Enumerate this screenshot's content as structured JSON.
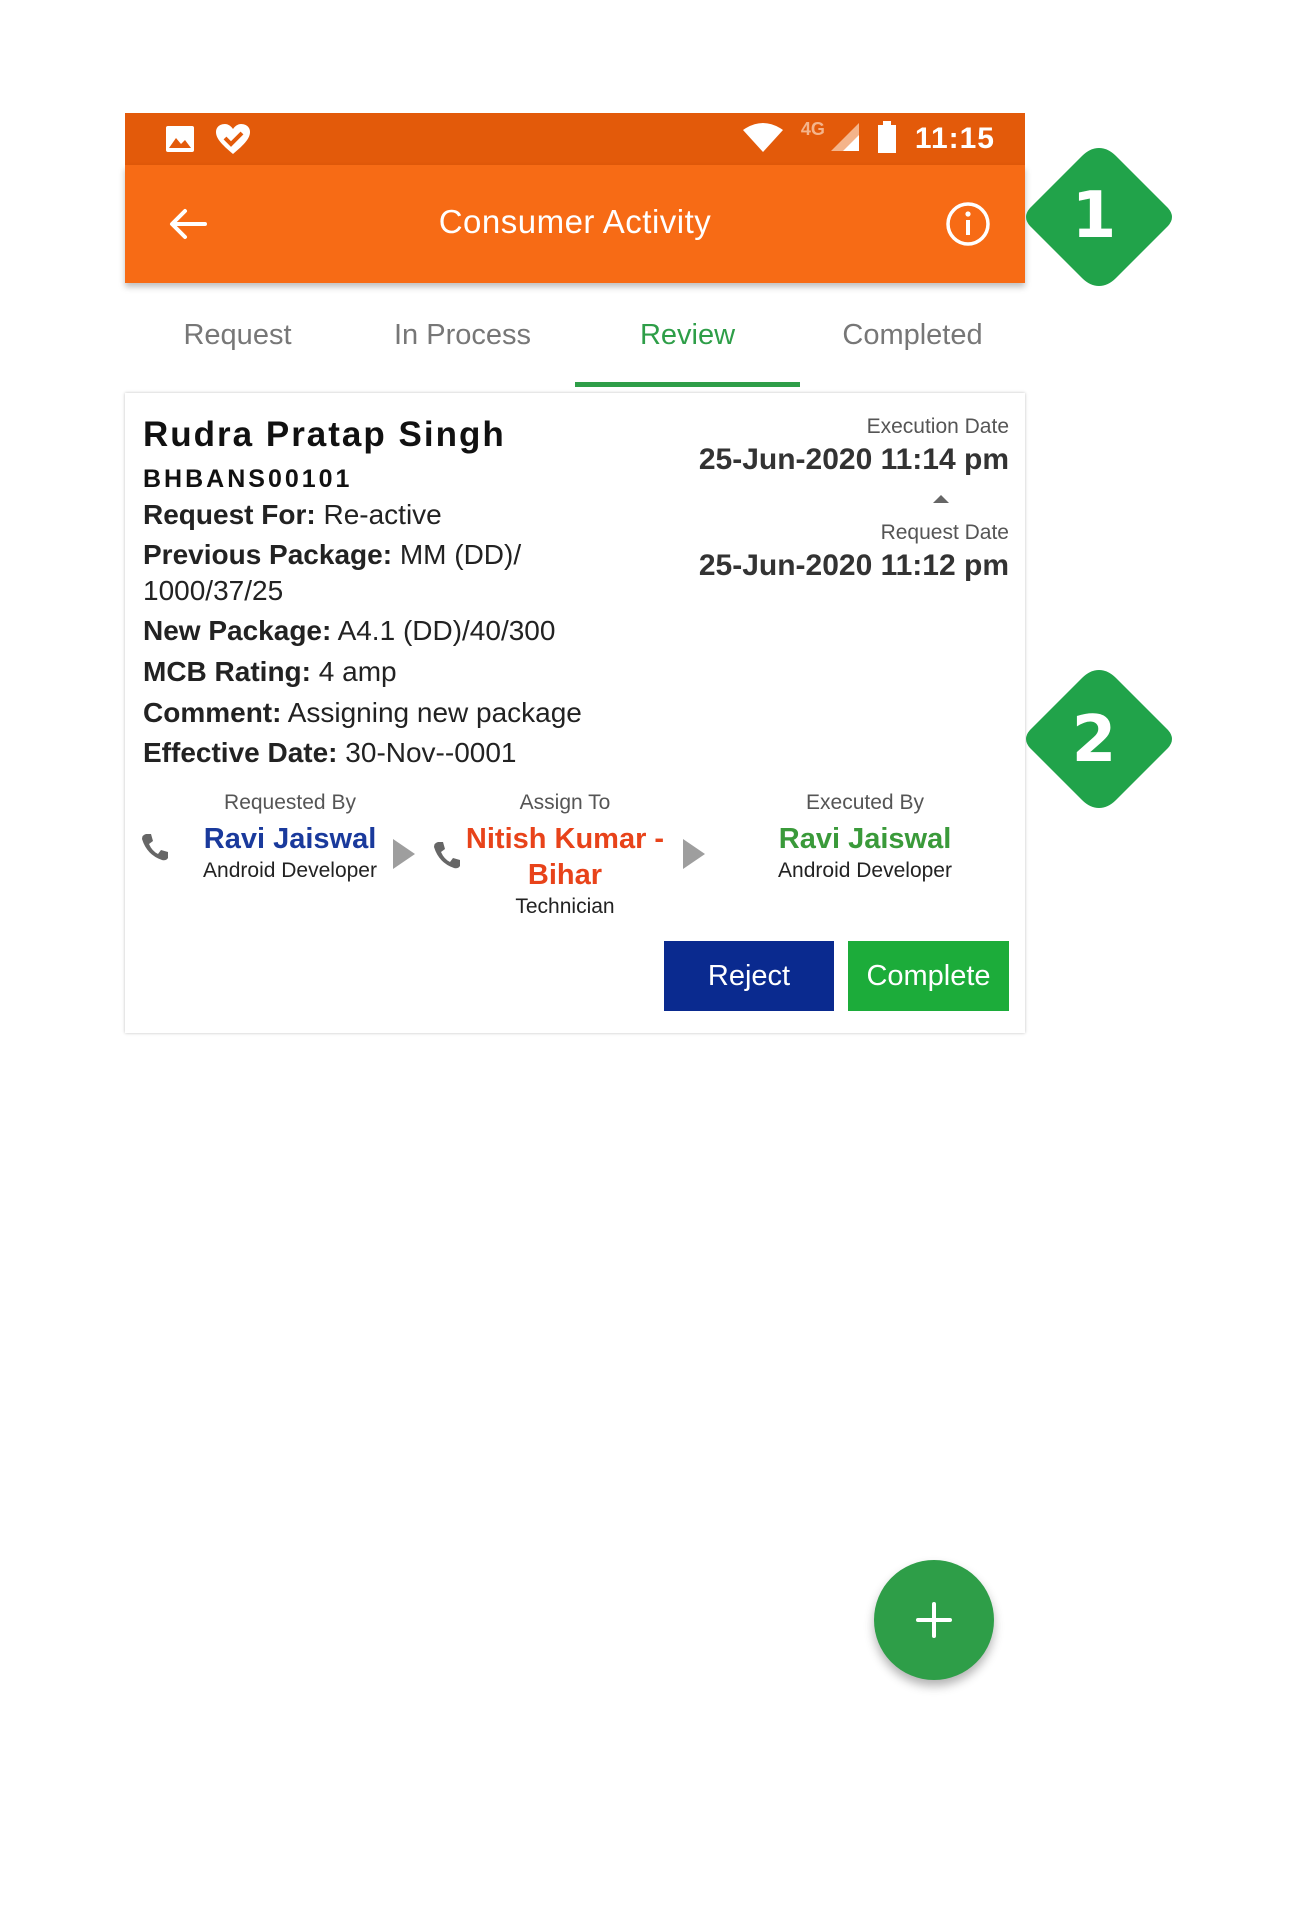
{
  "status_bar": {
    "time": "11:15",
    "network": "4G"
  },
  "app_bar": {
    "title": "Consumer Activity"
  },
  "tabs": [
    {
      "label": "Request",
      "active": false
    },
    {
      "label": "In Process",
      "active": false
    },
    {
      "label": "Review",
      "active": true
    },
    {
      "label": "Completed",
      "active": false
    }
  ],
  "card": {
    "name": "Rudra Pratap Singh",
    "code": "BHBANS00101",
    "request_for_label": "Request For:",
    "request_for_value": "Re-active",
    "previous_package_label": "Previous Package:",
    "previous_package_value_1": "MM (DD)/",
    "previous_package_value_2": "1000/37/25",
    "new_package_label": "New Package:",
    "new_package_value": "A4.1 (DD)/40/300",
    "mcb_rating_label": "MCB Rating:",
    "mcb_rating_value": "4 amp",
    "comment_label": "Comment:",
    "comment_value": "Assigning new package",
    "effective_date_label": "Effective Date:",
    "effective_date_value": "30-Nov--0001",
    "execution_date_label": "Execution Date",
    "execution_date_value": "25-Jun-2020 11:14 pm",
    "request_date_label": "Request Date",
    "request_date_value": "25-Jun-2020 11:12 pm",
    "requested_by": {
      "label": "Requested By",
      "name": "Ravi Jaiswal",
      "role": "Android Developer"
    },
    "assign_to": {
      "label": "Assign To",
      "name_1": "Nitish Kumar -",
      "name_2": "Bihar",
      "role": "Technician"
    },
    "executed_by": {
      "label": "Executed By",
      "name": "Ravi Jaiswal",
      "role": "Android Developer"
    },
    "reject_label": "Reject",
    "complete_label": "Complete"
  },
  "badges": {
    "badge_1": "1",
    "badge_2": "2"
  },
  "colors": {
    "status_bar": "#e35a0a",
    "app_bar": "#f76b15",
    "accent_green": "#2e9e48",
    "reject_blue": "#0a2a8f",
    "complete_green": "#1cac3a",
    "requested_name": "#1a3a9c",
    "assign_name": "#e8431a",
    "executed_name": "#3a9a3a"
  },
  "icons": [
    "image-icon",
    "heart-check-icon",
    "wifi-icon",
    "signal-icon",
    "battery-icon",
    "back-arrow-icon",
    "info-icon",
    "phone-icon",
    "plus-icon"
  ]
}
